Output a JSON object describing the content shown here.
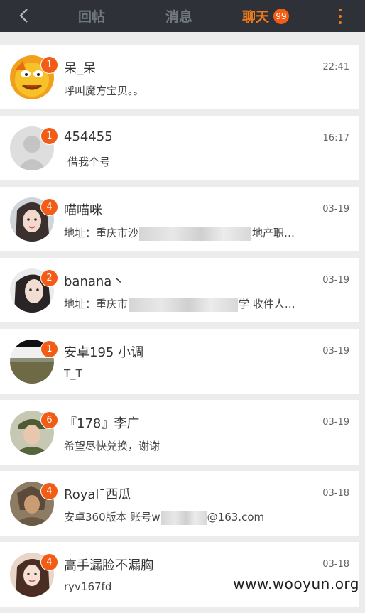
{
  "topbar": {
    "tabs": [
      {
        "label": "回帖",
        "active": false
      },
      {
        "label": "消息",
        "active": false
      },
      {
        "label": "聊天",
        "active": true,
        "badge": "99"
      }
    ],
    "back_icon": "chevron-left-icon",
    "more_icon": "more-vertical-icon"
  },
  "colors": {
    "accent": "#f07a1a",
    "badge": "#f25c14",
    "topbar": "#2e3238"
  },
  "chats": [
    {
      "name": "呆_呆",
      "time": "22:41",
      "badge": "1",
      "message": "呼叫魔方宝贝。。"
    },
    {
      "name": "454455",
      "time": "16:17",
      "badge": "1",
      "message": "借我个号"
    },
    {
      "name": "喵喵咪",
      "time": "03-19",
      "badge": "4",
      "message_start": "地址：重庆市沙",
      "message_end": "地产职…"
    },
    {
      "name": "banana丶",
      "time": "03-19",
      "badge": "2",
      "message_start": "地址：重庆市",
      "message_end": "学 收件人…"
    },
    {
      "name": "安卓195 小调",
      "time": "03-19",
      "badge": "1",
      "message": "T_T"
    },
    {
      "name": "『178』李广",
      "time": "03-19",
      "badge": "6",
      "message": "希望尽快兑换，谢谢"
    },
    {
      "name": "Royal¯西瓜",
      "time": "03-18",
      "badge": "4",
      "message_start": "安卓360版本  账号w",
      "message_end": "@163.com"
    },
    {
      "name": "高手漏脸不漏胸",
      "time": "03-18",
      "badge": "4",
      "message": "ryv167fd"
    }
  ],
  "watermark": "www.wooyun.org"
}
